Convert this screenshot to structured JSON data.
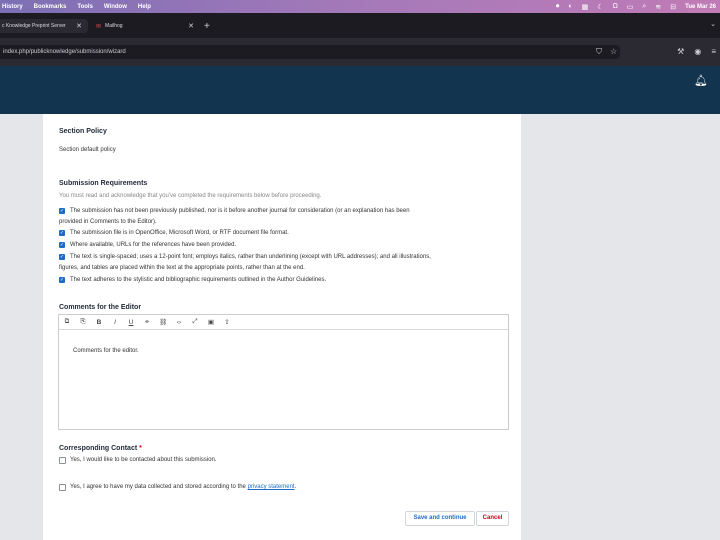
{
  "menubar": {
    "items": [
      "History",
      "Bookmarks",
      "Tools",
      "Window",
      "Help"
    ],
    "clock": "Tue Mar 26"
  },
  "tabs": [
    {
      "label": "c Knowledge Preprint Server"
    },
    {
      "label": "Mailhog"
    }
  ],
  "address_bar": {
    "url": "index.php/publicknowledge/submission/wizard"
  },
  "section_policy": {
    "title": "Section Policy",
    "text": "Section default policy"
  },
  "submission_requirements": {
    "title": "Submission Requirements",
    "instruction": "You must read and acknowledge that you've completed the requirements below before proceeding.",
    "items": [
      {
        "line1": "The submission has not been previously published, nor is it before another journal for consideration (or an explanation has been",
        "line2": "provided in Comments to the Editor)."
      },
      {
        "line1": "The submission file is in OpenOffice, Microsoft Word, or RTF document file format.",
        "line2": ""
      },
      {
        "line1": "Where available, URLs for the references have been provided.",
        "line2": ""
      },
      {
        "line1": "The text is single-spaced; uses a 12-point font; employs italics, rather than underlining (except with URL addresses); and all illustrations,",
        "line2": "figures, and tables are placed within the text at the appropriate points, rather than at the end."
      },
      {
        "line1": "The text adheres to the stylistic and bibliographic requirements outlined in the Author Guidelines.",
        "line2": ""
      }
    ]
  },
  "comments": {
    "title": "Comments for the Editor",
    "placeholder": "Comments for the editor."
  },
  "contact": {
    "title": "Corresponding Contact",
    "required_mark": "*",
    "option": "Yes, I would like to be contacted about this submission."
  },
  "privacy": {
    "text": "Yes, I agree to have my data collected and stored according to the",
    "link": "privacy statement",
    "end": "."
  },
  "buttons": {
    "save": "Save and continue",
    "cancel": "Cancel"
  },
  "colors": {
    "app_header": "#12344f",
    "accent": "#1e6bc6",
    "danger": "#d0021b"
  }
}
